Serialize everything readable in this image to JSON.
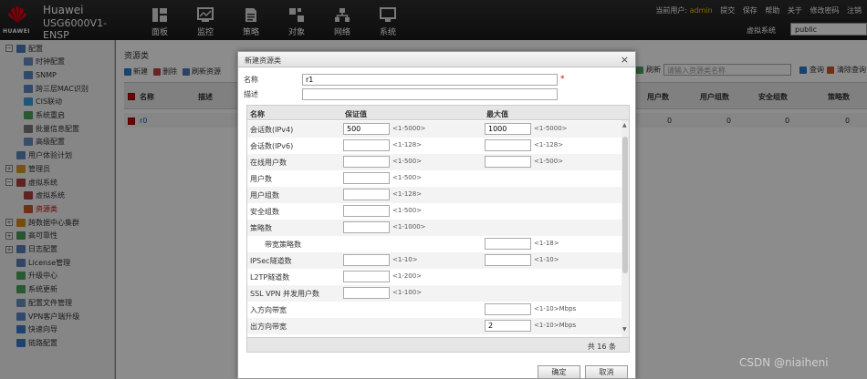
{
  "header": {
    "brand_name": "Huawei",
    "brand_model": "USG6000V1-ENSP",
    "logo_text": "HUAWEI",
    "nav": [
      {
        "label": "面板",
        "icon": "dashboard-icon"
      },
      {
        "label": "监控",
        "icon": "monitor-icon"
      },
      {
        "label": "策略",
        "icon": "policy-icon"
      },
      {
        "label": "对象",
        "icon": "object-icon"
      },
      {
        "label": "网络",
        "icon": "network-icon"
      },
      {
        "label": "系统",
        "icon": "system-icon"
      }
    ],
    "current_user_label": "当前用户:",
    "current_user": "admin",
    "links": [
      "提交",
      "保存",
      "帮助",
      "关于",
      "修改密码",
      "注销"
    ],
    "vsys_label": "虚拟系统",
    "vsys_value": "public"
  },
  "sidebar": {
    "items": [
      {
        "label": "配置",
        "toggle": "−",
        "color": "#4a7ab5"
      },
      {
        "label": "时钟配置",
        "color": "#6a8fc0"
      },
      {
        "label": "SNMP",
        "color": "#5b87c2"
      },
      {
        "label": "跨三层MAC识别",
        "color": "#5b87c2"
      },
      {
        "label": "CIS联动",
        "color": "#3a9fd8"
      },
      {
        "label": "系统重启",
        "color": "#4aa35a"
      },
      {
        "label": "批量信息配置",
        "color": "#7a7a7a"
      },
      {
        "label": "高级配置",
        "color": "#6a8fc0"
      },
      {
        "label": "用户体验计划",
        "color": "#5b87c2"
      },
      {
        "label": "管理员",
        "toggle": "+",
        "color": "#d69b2a"
      },
      {
        "label": "虚拟系统",
        "toggle": "−",
        "color": "#b04040"
      },
      {
        "label": "虚拟系统",
        "color": "#b04040"
      },
      {
        "label": "资源类",
        "color": "#c85a2a",
        "selected": true
      },
      {
        "label": "跨数据中心集群",
        "toggle": "+",
        "color": "#d28a20"
      },
      {
        "label": "高可靠性",
        "toggle": "+",
        "color": "#4a9a5a"
      },
      {
        "label": "日志配置",
        "toggle": "+",
        "color": "#5a80b8"
      },
      {
        "label": "License管理",
        "color": "#5a80b8"
      },
      {
        "label": "升级中心",
        "color": "#4aa35a"
      },
      {
        "label": "系统更新",
        "color": "#4aa35a"
      },
      {
        "label": "配置文件管理",
        "color": "#6a8fc0"
      },
      {
        "label": "VPN客户端升级",
        "color": "#5b87c2"
      },
      {
        "label": "快速向导",
        "color": "#3a7ac8"
      },
      {
        "label": "链路配置",
        "color": "#3a7ac8"
      }
    ]
  },
  "main": {
    "title": "资源类",
    "toolbar": [
      {
        "label": "新建",
        "color": "#2a7ac8"
      },
      {
        "label": "删除",
        "color": "#c04040"
      },
      {
        "label": "刷新资源",
        "color": "#4a7ab5"
      }
    ],
    "refresh_label": "刷新",
    "search_placeholder": "请输入资源类名称",
    "query_label": "查询",
    "clear_label": "清除查询",
    "columns": [
      "名称",
      "描述",
      "用户数",
      "用户组数",
      "安全组数",
      "策略数"
    ],
    "row": {
      "name": "r0",
      "users": "0",
      "user_groups": "0",
      "sec_groups": "0",
      "policies": "0"
    }
  },
  "modal": {
    "title": "新建资源类",
    "name_label": "名称",
    "name_value": "r1",
    "required_mark": "*",
    "desc_label": "描述",
    "desc_value": "",
    "col_name": "名称",
    "col_guarantee": "保证值",
    "col_max": "最大值",
    "rows": [
      {
        "name": "会话数(IPv4)",
        "g": "500",
        "g_range": "<1-5000>",
        "m": "1000",
        "m_range": "<1-5000>"
      },
      {
        "name": "会话数(IPv6)",
        "g": "",
        "g_range": "<1-128>",
        "m": "",
        "m_range": "<1-128>"
      },
      {
        "name": "在线用户数",
        "g": "",
        "g_range": "<1-500>",
        "m": "",
        "m_range": "<1-500>"
      },
      {
        "name": "用户数",
        "g": "",
        "g_range": "<1-500>"
      },
      {
        "name": "用户组数",
        "g": "",
        "g_range": "<1-128>"
      },
      {
        "name": "安全组数",
        "g": "",
        "g_range": "<1-500>"
      },
      {
        "name": "策略数",
        "g": "",
        "g_range": "<1-1000>"
      },
      {
        "name": "带宽策略数",
        "indent": true,
        "m": "",
        "m_range": "<1-18>"
      },
      {
        "name": "IPSec隧道数",
        "g": "",
        "g_range": "<1-10>",
        "m": "",
        "m_range": "<1-10>"
      },
      {
        "name": "L2TP隧道数",
        "g": "",
        "g_range": "<1-200>"
      },
      {
        "name": "SSL VPN 并发用户数",
        "g": "",
        "g_range": "<1-100>"
      },
      {
        "name": "入方向带宽",
        "m": "",
        "m_range": "<1-10>Mbps"
      },
      {
        "name": "出方向带宽",
        "m": "2",
        "m_range": "<1-10>Mbps"
      }
    ],
    "total": "共 16 条",
    "ok_label": "确定",
    "cancel_label": "取消"
  },
  "watermark": "CSDN @niaiheni"
}
